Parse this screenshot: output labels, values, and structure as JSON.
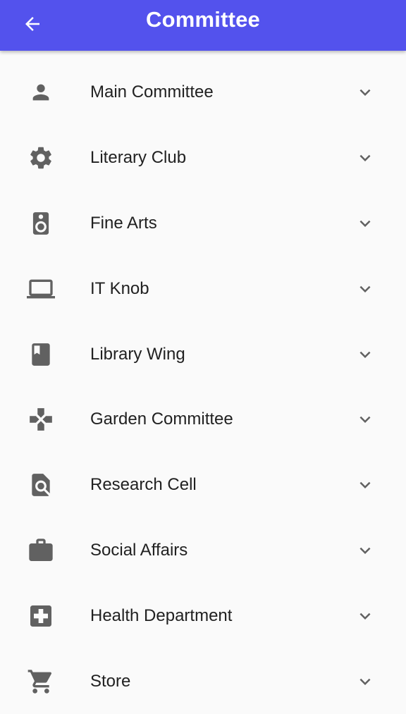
{
  "header": {
    "title": "Committee",
    "background_color": "#5352ed",
    "back_icon": "arrow-left-icon"
  },
  "colors": {
    "icon": "#616161",
    "text": "#212121",
    "background": "#fafafa"
  },
  "committees": [
    {
      "label": "Main Committee",
      "icon": "person-icon"
    },
    {
      "label": "Literary Club",
      "icon": "gear-icon"
    },
    {
      "label": "Fine Arts",
      "icon": "speaker-icon"
    },
    {
      "label": "IT Knob",
      "icon": "laptop-icon"
    },
    {
      "label": "Library Wing",
      "icon": "book-icon"
    },
    {
      "label": "Garden Committee",
      "icon": "gamepad-icon"
    },
    {
      "label": "Research Cell",
      "icon": "find-in-page-icon"
    },
    {
      "label": "Social Affairs",
      "icon": "briefcase-icon"
    },
    {
      "label": "Health Department",
      "icon": "medical-plus-icon"
    },
    {
      "label": "Store",
      "icon": "shopping-cart-icon"
    }
  ]
}
